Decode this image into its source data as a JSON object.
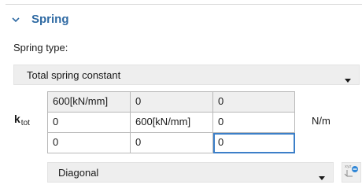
{
  "section": {
    "title": "Spring",
    "icon": "chevron-down-icon",
    "title_color": "#2f6aa3"
  },
  "spring_type": {
    "label": "Spring type:",
    "selected": "Total spring constant",
    "icon": "caret-down-icon"
  },
  "stiffness": {
    "symbol": "k",
    "subscript": "tot",
    "unit": "N/m",
    "matrix": [
      [
        "600[kN/mm]",
        "0",
        "0"
      ],
      [
        "0",
        "600[kN/mm]",
        "0"
      ],
      [
        "0",
        "0",
        "0"
      ]
    ],
    "focused_cell": "row 3, column 3",
    "focus_color": "#3c7fc8"
  },
  "matrix_type": {
    "selected": "Diagonal",
    "icon": "caret-down-icon"
  },
  "side_button": {
    "icon": "coordinate-system-icon",
    "icon_lettering": "xyz"
  }
}
